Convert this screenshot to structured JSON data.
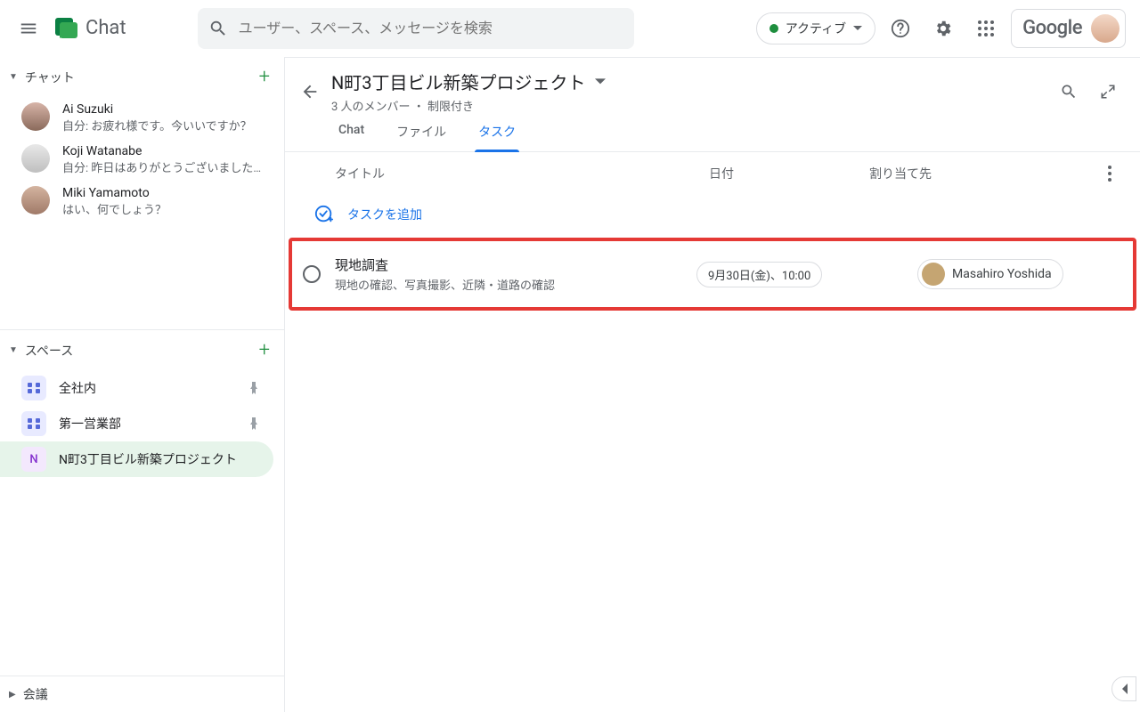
{
  "header": {
    "app_name": "Chat",
    "search_placeholder": "ユーザー、スペース、メッセージを検索",
    "status_label": "アクティブ",
    "google_label": "Google"
  },
  "sidebar": {
    "chats_label": "チャット",
    "spaces_label": "スペース",
    "meet_label": "会議",
    "dms": [
      {
        "name": "Ai Suzuki",
        "msg": "自分: お疲れ様です。今いいですか？"
      },
      {
        "name": "Koji Watanabe",
        "msg": "自分: 昨日はありがとうございました…"
      },
      {
        "name": "Miki Yamamoto",
        "msg": "はい、何でしょう？"
      }
    ],
    "spaces": [
      {
        "initial": "⌂",
        "name": "全社内",
        "pinned": true
      },
      {
        "initial": "⌂",
        "name": "第一営業部",
        "pinned": true
      },
      {
        "initial": "N",
        "name": "N町3丁目ビル新築プロジェクト",
        "pinned": false,
        "active": true
      }
    ]
  },
  "space": {
    "title": "N町3丁目ビル新築プロジェクト",
    "subtitle": "3 人のメンバー ・ 制限付き",
    "tabs": {
      "chat": "Chat",
      "files": "ファイル",
      "tasks": "タスク"
    },
    "columns": {
      "title": "タイトル",
      "date": "日付",
      "assignee": "割り当て先"
    },
    "add_task_label": "タスクを追加",
    "task": {
      "title": "現地調査",
      "desc": "現地の確認、写真撮影、近隣・道路の確認",
      "date": "9月30日(金)、10:00",
      "assignee": "Masahiro Yoshida"
    }
  }
}
